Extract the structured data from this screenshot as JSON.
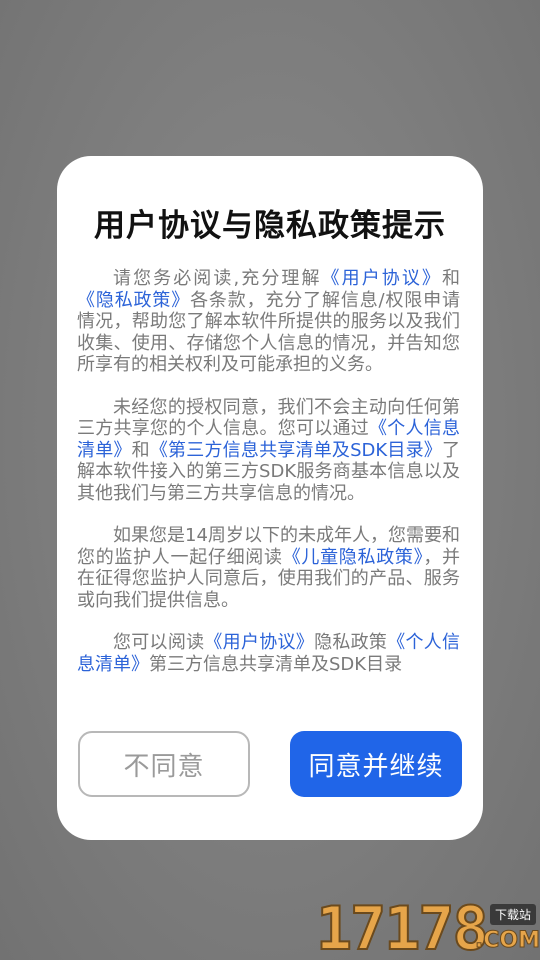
{
  "dialog": {
    "title": "用户协议与隐私政策提示",
    "paragraphs": [
      [
        {
          "t": "请您务必阅读,充分理解"
        },
        {
          "t": "《用户协议》",
          "link": true
        },
        {
          "t": "和"
        },
        {
          "t": "《隐私政策》",
          "link": true
        },
        {
          "t": "各条款，充分了解信息/权限申请情况，帮助您了解本软件所提供的服务以及我们收集、使用、存储您个人信息的情况，并告知您所享有的相关权利及可能承担的义务。"
        }
      ],
      [
        {
          "t": "未经您的授权同意，我们不会主动向任何第三方共享您的个人信息。您可以通过"
        },
        {
          "t": "《个人信息清单》",
          "link": true
        },
        {
          "t": "和"
        },
        {
          "t": "《第三方信息共享清单及SDK目录》",
          "link": true
        },
        {
          "t": "了解本软件接入的第三方SDK服务商基本信息以及其他我们与第三方共享信息的情况。"
        }
      ],
      [
        {
          "t": "如果您是14周岁以下的未成年人，您需要和您的监护人一起仔细阅读"
        },
        {
          "t": "《儿童隐私政策》",
          "link": true
        },
        {
          "t": "，并在征得您监护人同意后，使用我们的产品、服务或向我们提供信息。"
        }
      ],
      [
        {
          "t": "您可以阅读"
        },
        {
          "t": "《用户协议》",
          "link": true
        },
        {
          "t": "隐私政策"
        },
        {
          "t": "《个人信息清单》",
          "link": true
        },
        {
          "t": "第三方信息共享清单及SDK目录"
        }
      ]
    ],
    "disagree_label": "不同意",
    "agree_label": "同意并继续"
  },
  "watermark": {
    "digits": "17178",
    "tag": "下载站",
    "suffix": ".COM"
  },
  "colors": {
    "link": "#2c63d8",
    "primary_button": "#2065e8",
    "body_text": "#7a7a7a",
    "backdrop": "#7d7d7d"
  }
}
